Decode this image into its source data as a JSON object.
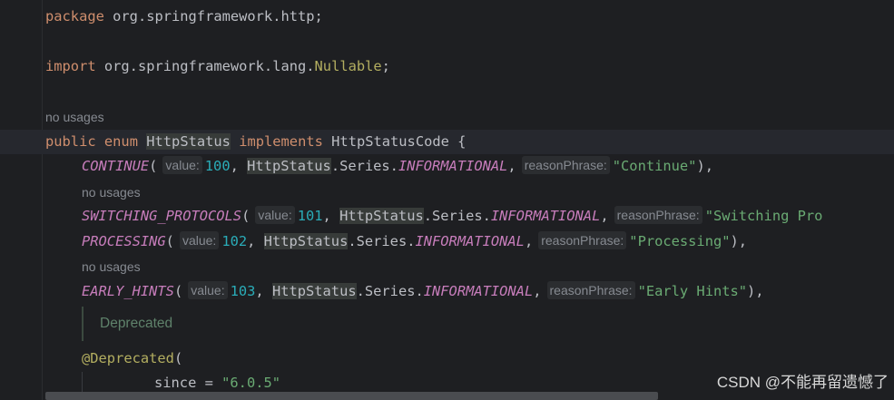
{
  "code": {
    "package_kw": "package",
    "package_name": " org.springframework.http;",
    "import_kw": "import",
    "import_path": " org.springframework.lang.",
    "import_class": "Nullable",
    "import_end": ";",
    "usages_hint": "no usages",
    "decl_public": "public",
    "decl_enum": "enum",
    "decl_name": "HttpStatus",
    "decl_implements": "implements",
    "decl_iface": "HttpStatusCode {",
    "param_value": "value:",
    "param_reason": "reasonPhrase:",
    "series_class": "HttpStatus",
    "series_mid": ".Series.",
    "series_informational": "INFORMATIONAL",
    "constants": [
      {
        "name": "CONTINUE",
        "code": "100",
        "phrase": "\"Continue\"",
        "end": "),",
        "has_usage_hint": false
      },
      {
        "name": "SWITCHING_PROTOCOLS",
        "code": "101",
        "phrase": "\"Switching Pro",
        "end": "",
        "has_usage_hint": true
      },
      {
        "name": "PROCESSING",
        "code": "102",
        "phrase": "\"Processing\"",
        "end": "),",
        "has_usage_hint": false
      },
      {
        "name": "EARLY_HINTS",
        "code": "103",
        "phrase": "\"Early Hints\"",
        "end": "),",
        "has_usage_hint": true
      }
    ],
    "deprecated_doc": "Deprecated",
    "annotation": "@Deprecated",
    "annotation_open": "(",
    "since_key": "since = ",
    "since_value": "\"6.0.5\""
  },
  "colors": {
    "background": "#1e1f22",
    "keyword": "#cf8e6d",
    "constant": "#c77dbb",
    "number": "#2aacb8",
    "string": "#6aab73",
    "annotation": "#b3ae60"
  },
  "watermark": "CSDN @不能再留遗憾了"
}
